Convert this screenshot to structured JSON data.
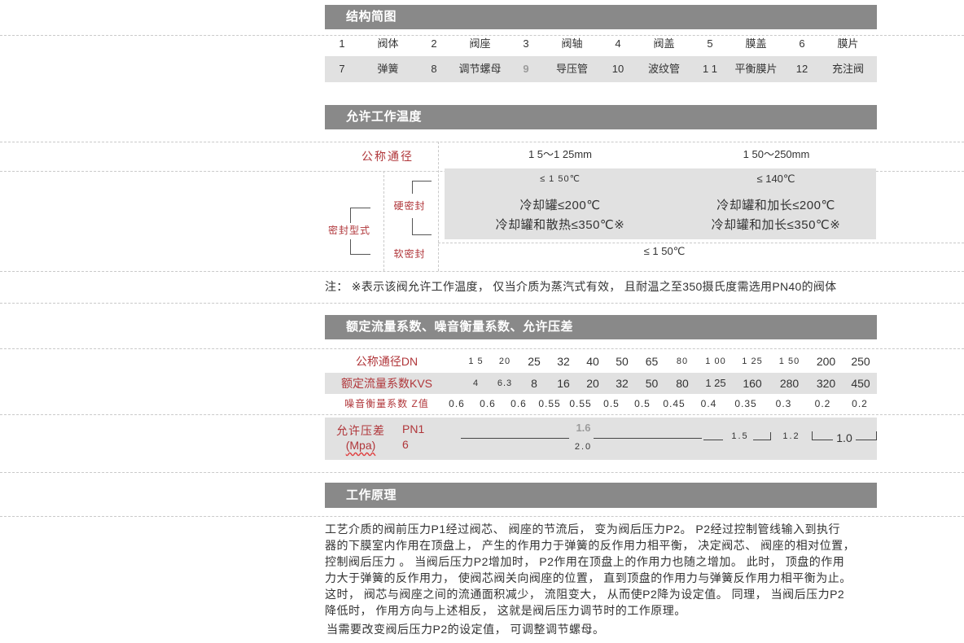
{
  "colors": {
    "header_bg": "#898989",
    "row_bg": "#e1e1e1",
    "label_red": "#b0363a",
    "text": "#333333",
    "muted": "#9b9b9b",
    "divider": "#c9c9c9"
  },
  "structure": {
    "title": "结构简图",
    "row1": [
      {
        "no": "1",
        "name": "阀体"
      },
      {
        "no": "2",
        "name": "阀座"
      },
      {
        "no": "3",
        "name": "阀轴"
      },
      {
        "no": "4",
        "name": "阀盖"
      },
      {
        "no": "5",
        "name": "膜盖"
      },
      {
        "no": "6",
        "name": "膜片"
      }
    ],
    "row2": [
      {
        "no": "7",
        "name": "弹簧"
      },
      {
        "no": "8",
        "name": "调节螺母"
      },
      {
        "no": "9",
        "name": "导压管"
      },
      {
        "no": "10",
        "name": "波纹管"
      },
      {
        "no": "1 1",
        "name": "平衡膜片"
      },
      {
        "no": "12",
        "name": "充注阀"
      }
    ]
  },
  "temperature": {
    "title": "允许工作温度",
    "nominal_label": "公称通径",
    "ranges": [
      "1 5～1 25mm",
      "1 50～250mm"
    ],
    "seal_type_label": "密封型式",
    "hard_seal": {
      "label": "硬密封",
      "columns": [
        {
          "base": "≤ 1 50℃",
          "cooling": "冷却罐≤200℃",
          "extended": "冷却罐和散热≤350℃※"
        },
        {
          "base": "≤ 140℃",
          "cooling": "冷却罐和加长≤200℃",
          "extended": "冷却罐和加长≤350℃※"
        }
      ]
    },
    "soft_seal": {
      "label": "软密封",
      "value": "≤ 1 50℃"
    },
    "note": "注： ※表示该阀允许工作温度， 仅当介质为蒸汽式有效， 且耐温之至350摄氏度需选用PN40的阀体"
  },
  "flow": {
    "title": "额定流量系数、噪音衡量系数、允许压差",
    "dn_label": "公称通径DN",
    "dn": [
      "1 5",
      "20",
      "25",
      "32",
      "40",
      "50",
      "65",
      "80",
      "1 00",
      "1 25",
      "1 50",
      "200",
      "250"
    ],
    "kvs_label": "额定流量系数KVS",
    "kvs": [
      "4",
      "6.3",
      "8",
      "16",
      "20",
      "32",
      "50",
      "80",
      "1 25",
      "160",
      "280",
      "320",
      "450"
    ],
    "z_label": "噪音衡量系数 Z值",
    "z": [
      "0.6",
      "0.6",
      "0.6",
      "0.55",
      "0.55",
      "0.5",
      "0.5",
      "0.45",
      "0.4",
      "0.35",
      "0.3",
      "0.2",
      "0.2"
    ],
    "pressure": {
      "label": "允许压差",
      "unit": "(Mpa)",
      "class": "PN16",
      "values": [
        "1.6",
        "2.0",
        "1.5",
        "1.2",
        "1.0"
      ]
    }
  },
  "principle": {
    "title": "工作原理",
    "lines": [
      "工艺介质的阀前压力P1经过阀芯、 阀座的节流后， 变为阀后压力P2。 P2经过控制管线输入到执行",
      "器的下膜室内作用在顶盘上， 产生的作用力于弹簧的反作用力相平衡， 决定阀芯、 阀座的相对位置，",
      "控制阀后压力 。 当阀后压力P2增加时， P2作用在顶盘上的作用力也随之增加。 此时， 顶盘的作用",
      "力大于弹簧的反作用力， 使阀芯阀关向阀座的位置， 直到顶盘的作用力与弹簧反作用力相平衡为止。",
      "这时， 阀芯与阀座之间的流通面积减少， 流阻变大， 从而使P2降为设定值。  同理， 当阀后压力P2",
      "降低时， 作用方向与上述相反， 这就是阀后压力调节时的工作原理。"
    ],
    "footer": "当需要改变阀后压力P2的设定值， 可调整调节螺母。"
  }
}
